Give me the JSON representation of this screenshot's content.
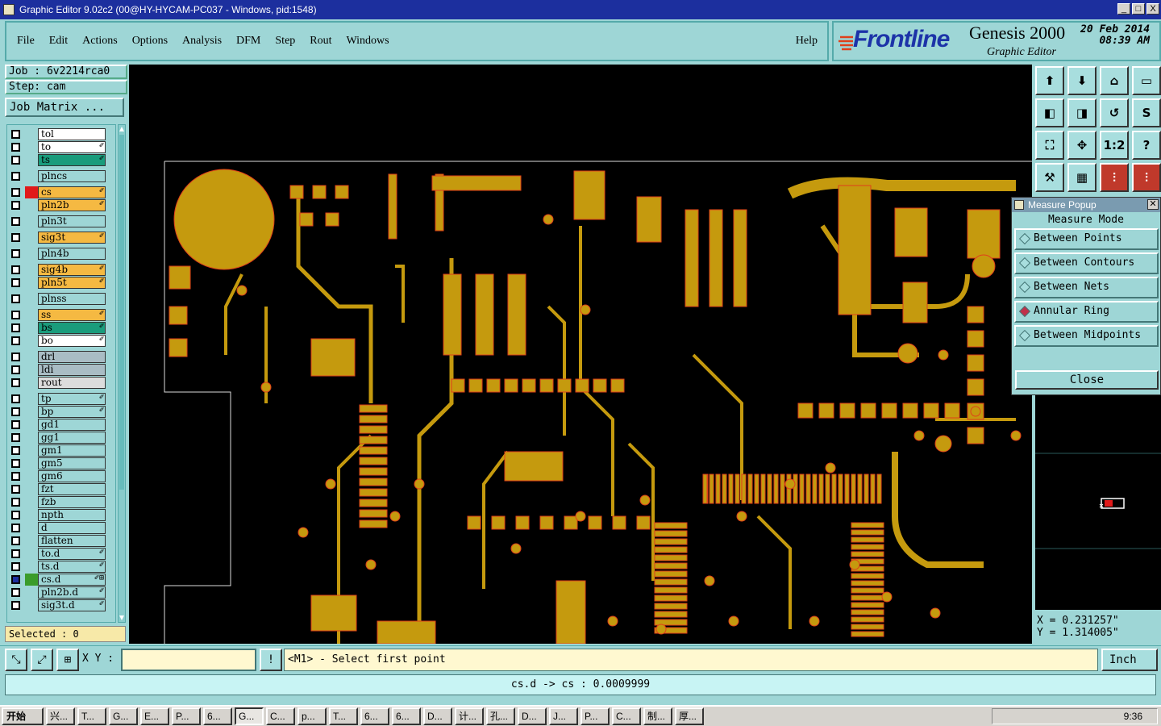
{
  "window": {
    "title": "Graphic Editor 9.02c2 (00@HY-HYCAM-PC037 - Windows, pid:1548)",
    "controls": [
      "_",
      "□",
      "X"
    ]
  },
  "menu": {
    "items": [
      "File",
      "Edit",
      "Actions",
      "Options",
      "Analysis",
      "DFM",
      "Step",
      "Rout",
      "Windows"
    ],
    "help": "Help"
  },
  "brand": {
    "logo": "Frontline",
    "product": "Genesis 2000",
    "subtitle": "Graphic Editor",
    "date": "20 Feb 2014",
    "time": "08:39 AM"
  },
  "job": {
    "job_label": "Job  :  6v2214rca0",
    "step_label": "Step:  cam",
    "matrix_button": "Job Matrix ..."
  },
  "layers": [
    {
      "name": "tol",
      "color": "#ffffff",
      "swatch": "",
      "edit": ""
    },
    {
      "name": "to",
      "color": "#ffffff",
      "swatch": "",
      "edit": "✐"
    },
    {
      "name": "ts",
      "color": "#1a9c7c",
      "swatch": "",
      "edit": "✐"
    },
    {
      "name": "plncs",
      "color": "#9ed6d6",
      "swatch": "",
      "edit": ""
    },
    {
      "name": "cs",
      "color": "#f5b942",
      "swatch": "#e01a1a",
      "edit": "✐"
    },
    {
      "name": "pln2b",
      "color": "#f5b942",
      "swatch": "",
      "edit": "✐"
    },
    {
      "name": "pln3t",
      "color": "#9ed6d6",
      "swatch": "",
      "edit": ""
    },
    {
      "name": "sig3t",
      "color": "#f5b942",
      "swatch": "",
      "edit": "✐"
    },
    {
      "name": "pln4b",
      "color": "#9ed6d6",
      "swatch": "",
      "edit": ""
    },
    {
      "name": "sig4b",
      "color": "#f5b942",
      "swatch": "",
      "edit": "✐"
    },
    {
      "name": "pln5t",
      "color": "#f5b942",
      "swatch": "",
      "edit": "✐"
    },
    {
      "name": "plnss",
      "color": "#9ed6d6",
      "swatch": "",
      "edit": ""
    },
    {
      "name": "ss",
      "color": "#f5b942",
      "swatch": "",
      "edit": "✐"
    },
    {
      "name": "bs",
      "color": "#1a9c7c",
      "swatch": "",
      "edit": "✐"
    },
    {
      "name": "bo",
      "color": "#ffffff",
      "swatch": "",
      "edit": "✐"
    },
    {
      "name": "drl",
      "color": "#a9bcc4",
      "swatch": "",
      "edit": ""
    },
    {
      "name": "ldi",
      "color": "#a9bcc4",
      "swatch": "",
      "edit": ""
    },
    {
      "name": "rout",
      "color": "#dcdcdc",
      "swatch": "",
      "edit": ""
    },
    {
      "name": "tp",
      "color": "#9ed6d6",
      "swatch": "",
      "edit": "✐"
    },
    {
      "name": "bp",
      "color": "#9ed6d6",
      "swatch": "",
      "edit": "✐"
    },
    {
      "name": "gd1",
      "color": "#9ed6d6",
      "swatch": "",
      "edit": ""
    },
    {
      "name": "gg1",
      "color": "#9ed6d6",
      "swatch": "",
      "edit": ""
    },
    {
      "name": "gm1",
      "color": "#9ed6d6",
      "swatch": "",
      "edit": ""
    },
    {
      "name": "gm5",
      "color": "#9ed6d6",
      "swatch": "",
      "edit": ""
    },
    {
      "name": "gm6",
      "color": "#9ed6d6",
      "swatch": "",
      "edit": ""
    },
    {
      "name": "fzt",
      "color": "#9ed6d6",
      "swatch": "",
      "edit": ""
    },
    {
      "name": "fzb",
      "color": "#9ed6d6",
      "swatch": "",
      "edit": ""
    },
    {
      "name": "npth",
      "color": "#9ed6d6",
      "swatch": "",
      "edit": ""
    },
    {
      "name": "d",
      "color": "#9ed6d6",
      "swatch": "",
      "edit": ""
    },
    {
      "name": "flatten",
      "color": "#9ed6d6",
      "swatch": "",
      "edit": ""
    },
    {
      "name": "to.d",
      "color": "#9ed6d6",
      "swatch": "",
      "edit": "✐"
    },
    {
      "name": "ts.d",
      "color": "#9ed6d6",
      "swatch": "",
      "edit": "✐"
    },
    {
      "name": "cs.d",
      "color": "#9ed6d6",
      "swatch": "#3a9c2a",
      "edit": "✐⊞",
      "checked": true
    },
    {
      "name": "pln2b.d",
      "color": "#9ed6d6",
      "swatch": "",
      "edit": "✐"
    },
    {
      "name": "sig3t.d",
      "color": "#9ed6d6",
      "swatch": "",
      "edit": "✐"
    }
  ],
  "selected": "Selected : 0",
  "measure": {
    "title": "Measure Popup",
    "mode_label": "Measure Mode",
    "options": [
      "Between Points",
      "Between Contours",
      "Between Nets",
      "Annular Ring",
      "Between Midpoints"
    ],
    "active_index": 3,
    "close": "Close"
  },
  "coords": {
    "x": "X  =  0.231257\"",
    "y": "Y  =  1.314005\""
  },
  "bottom": {
    "xy_label": "X Y :",
    "xy_value": "",
    "prompt": "<M1> - Select first point",
    "unit": "Inch"
  },
  "status": "cs.d -> cs : 0.0009999",
  "taskbar": {
    "start": "开始",
    "items": [
      "兴...",
      "T...",
      "G...",
      "E...",
      "P...",
      "6...",
      "G...",
      "C...",
      "p...",
      "T...",
      "6...",
      "6...",
      "D...",
      "计...",
      "孔...",
      "D...",
      "J...",
      "P...",
      "C...",
      "制...",
      "厚..."
    ],
    "active_index": 6,
    "clock": "9:36"
  },
  "colors": {
    "board": "#c59a0e",
    "outline": "#e0401a",
    "accent": "#1c2f9e"
  }
}
